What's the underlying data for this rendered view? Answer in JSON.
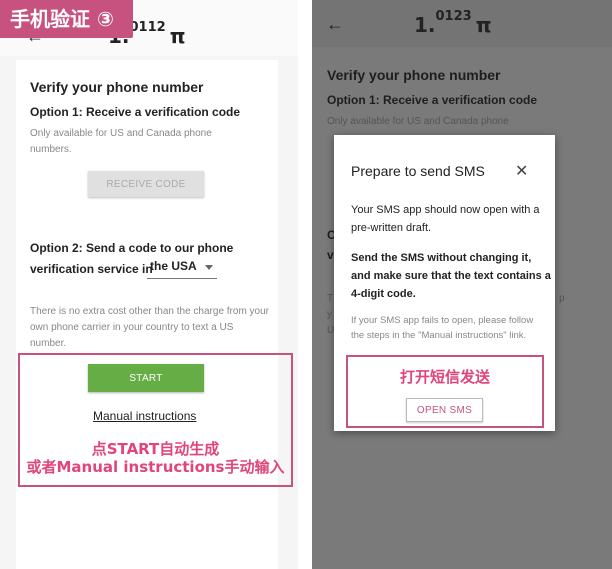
{
  "left": {
    "tag": "手机验证 ③",
    "back_icon": "←",
    "balance_main": "1.",
    "balance_sup": "0112",
    "pi_symbol": "π",
    "title": "Verify your phone number",
    "option1_title": "Option 1: Receive a verification code",
    "option1_note": "Only available for US and Canada phone numbers.",
    "receive_button": "RECEIVE CODE",
    "option2_title": "Option 2: Send a code to our phone verification service in",
    "country": "the USA",
    "option2_note": "There is no extra cost other than the charge from your own phone carrier in your country to text a US number.",
    "start_button": "START",
    "manual_link": "Manual instructions",
    "annotation_line1": "点START自动生成",
    "annotation_line2": "或者Manual instructions手动输入"
  },
  "right": {
    "back_icon": "←",
    "balance_main": "1.",
    "balance_sup": "0123",
    "pi_symbol": "π",
    "title": "Verify your phone number",
    "option1_title": "Option 1: Receive a verification code",
    "option1_note": "Only available for US and Canada phone",
    "frag_c": "C",
    "frag_v": "v",
    "frag_t": "T",
    "frag_y": "y",
    "frag_u": "U",
    "modal": {
      "title": "Prepare to send SMS",
      "close_icon": "✕",
      "p1": "Your SMS app should now open with a pre-written draft.",
      "p2": "Send the SMS without changing it, and make sure that the text contains a 4-digit code.",
      "p3": "If your SMS app fails to open, please follow the steps in the \"Manual instructions\" link.",
      "open_sms_button": "OPEN SMS"
    },
    "annotation": "打开短信发送"
  },
  "colors": {
    "accent_pink": "#c7527f",
    "start_green": "#67ad45",
    "overlay_gray": "#7a7a7a"
  }
}
